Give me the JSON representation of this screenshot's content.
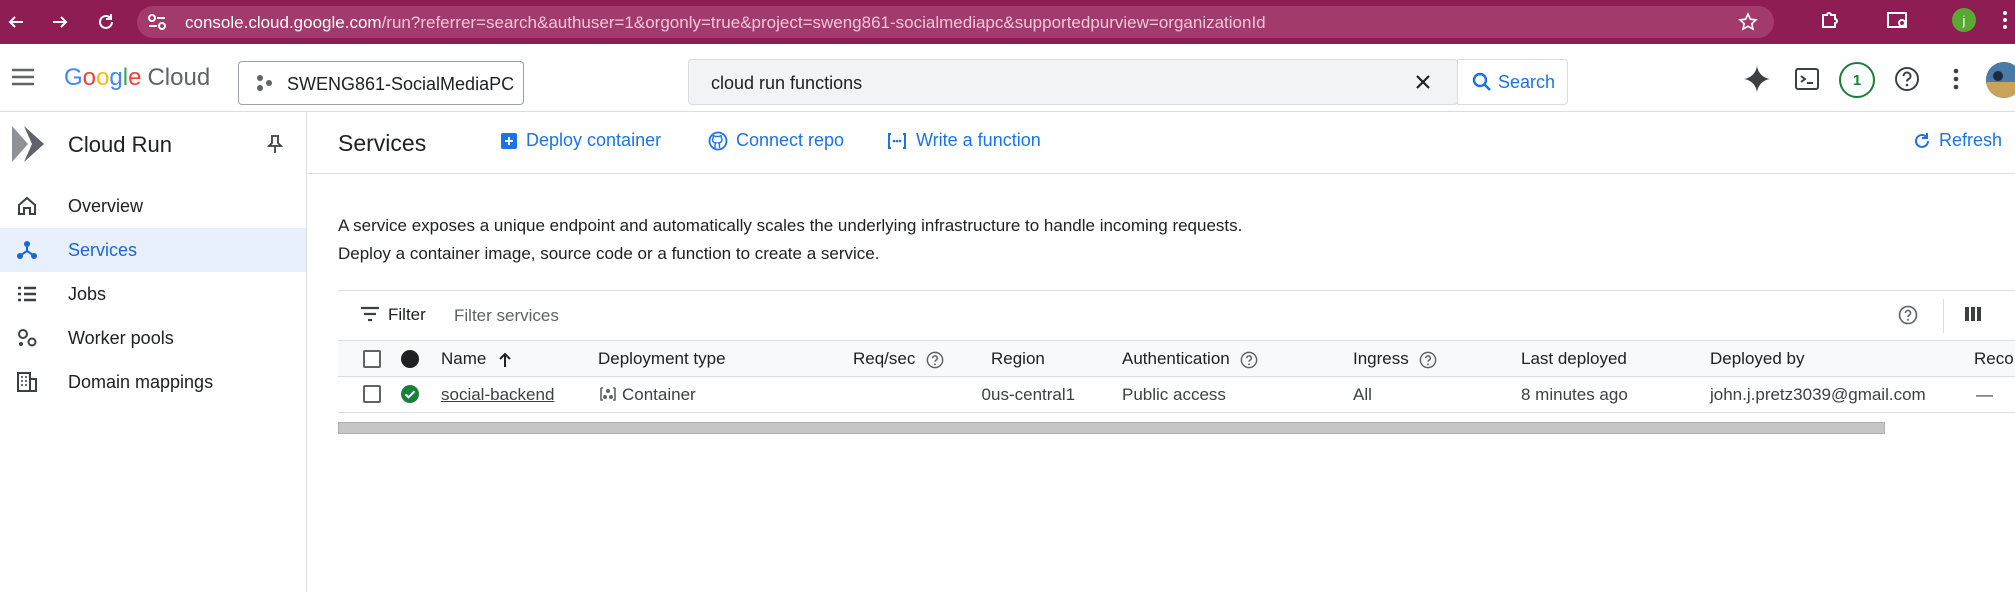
{
  "browser": {
    "url_host": "console.cloud.google.com",
    "url_path": "/run?referrer=search&authuser=1&orgonly=true&project=sweng861-socialmediapc&supportedpurview=organizationId",
    "profile_initial": "j"
  },
  "header": {
    "logo": {
      "g": "G",
      "o1": "o",
      "o2": "o",
      "g2": "g",
      "l": "l",
      "e": "e",
      "cloud": "Cloud"
    },
    "project": "SWENG861-SocialMediaPC",
    "search_value": "cloud run functions",
    "search_button": "Search",
    "notifications_count": "1"
  },
  "sidebar": {
    "title": "Cloud Run",
    "items": [
      {
        "label": "Overview"
      },
      {
        "label": "Services"
      },
      {
        "label": "Jobs"
      },
      {
        "label": "Worker pools"
      },
      {
        "label": "Domain mappings"
      }
    ]
  },
  "toolbar": {
    "title": "Services",
    "deploy_container": "Deploy container",
    "connect_repo": "Connect repo",
    "write_function": "Write a function",
    "refresh": "Refresh"
  },
  "description": {
    "line1": "A service exposes a unique endpoint and automatically scales the underlying infrastructure to handle incoming requests.",
    "line2": "Deploy a container image, source code or a function to create a service."
  },
  "filter": {
    "label": "Filter",
    "placeholder": "Filter services"
  },
  "table": {
    "columns": {
      "name": "Name",
      "deployment_type": "Deployment type",
      "req_sec": "Req/sec",
      "region": "Region",
      "authentication": "Authentication",
      "ingress": "Ingress",
      "last_deployed": "Last deployed",
      "deployed_by": "Deployed by",
      "recommendations": "Reco"
    },
    "rows": [
      {
        "name": "social-backend",
        "deployment_type": "Container",
        "req_sec": "0",
        "region": "us-central1",
        "authentication": "Public access",
        "ingress": "All",
        "last_deployed": "8 minutes ago",
        "deployed_by": "john.j.pretz3039@gmail.com",
        "recommendations": "—"
      }
    ]
  },
  "colors": {
    "chrome": "#8d1d53",
    "accent": "#1a73e8",
    "status_ok": "#188038"
  }
}
